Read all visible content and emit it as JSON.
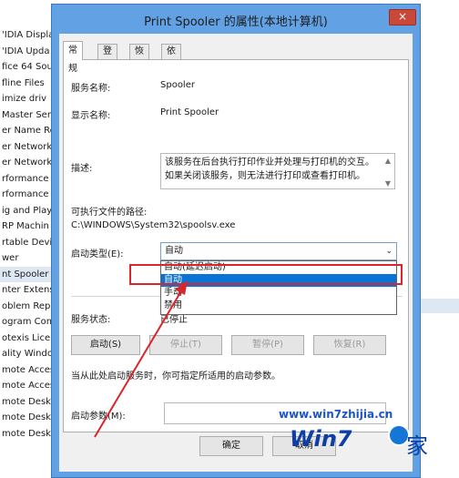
{
  "background_list": {
    "items": [
      "'IDIA Displa",
      "'IDIA Upda",
      "fice 64 Sou",
      "fline Files",
      "imize driv",
      "Master Ser",
      "er Name Re",
      "er Network",
      "er Network",
      "rformance",
      "rformance",
      "ig and Play",
      "RP Machin",
      "rtable Devi",
      "wer",
      "nt Spooler",
      "nter Extens",
      "oblem Repo",
      "ogram Com",
      "otexis Licen",
      "ality Windo",
      "mote Acces",
      "mote Acces",
      "mote Desk",
      "mote Desk",
      "mote Desk"
    ],
    "selected_index": 15
  },
  "dialog": {
    "title": "Print Spooler 的属性(本地计算机)",
    "close": "×"
  },
  "tabs": [
    "常规",
    "登录",
    "恢复",
    "依存关系"
  ],
  "general": {
    "service_name_label": "服务名称:",
    "service_name_value": "Spooler",
    "display_name_label": "显示名称:",
    "display_name_value": "Print Spooler",
    "description_label": "描述:",
    "description_value": "该服务在后台执行打印作业并处理与打印机的交互。如果关闭该服务，则无法进行打印或查看打印机。",
    "exe_path_label": "可执行文件的路径:",
    "exe_path_value": "C:\\WINDOWS\\System32\\spoolsv.exe",
    "startup_type_label": "启动类型(E):",
    "startup_type_value": "自动",
    "startup_options": [
      "自动(延迟启动)",
      "自动",
      "手动",
      "禁用"
    ],
    "startup_selected_index": 1,
    "service_status_label": "服务状态:",
    "service_status_value": "已停止",
    "buttons": {
      "start": "启动(S)",
      "stop": "停止(T)",
      "pause": "暂停(P)",
      "resume": "恢复(R)"
    },
    "hint_text": "当从此处启动服务时，你可指定所适用的启动参数。",
    "start_params_label": "启动参数(M):",
    "start_params_value": ""
  },
  "footer": {
    "ok": "确定",
    "cancel": "取消"
  },
  "watermark": {
    "url": "www.win7zhijia.cn",
    "logo": "Win7",
    "suffix": "家"
  },
  "colors": {
    "dialog_frame": "#62a2e4",
    "close_button": "#c9483a",
    "highlight": "#d9262c",
    "dropdown_selected": "#0a74d6"
  }
}
